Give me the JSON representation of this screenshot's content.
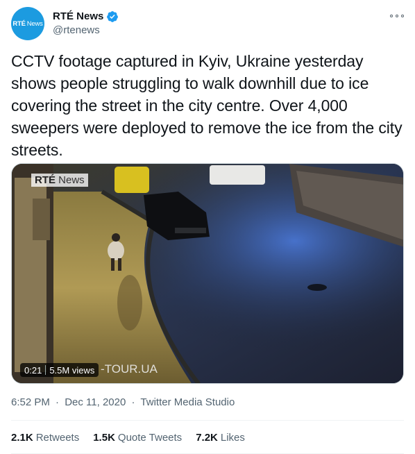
{
  "account": {
    "display_name": "RTÉ News",
    "handle": "@rtenews",
    "avatar_text_bold": "RTÉ",
    "avatar_text_thin": "News",
    "avatar_color": "#1c9be0",
    "verified": true
  },
  "tweet": {
    "text": "CCTV footage captured in Kyiv, Ukraine yesterday shows people struggling to walk downhill due to ice covering the street in the city centre. Over 4,000 sweepers were deployed to remove the ice from the city streets."
  },
  "media": {
    "watermark_bold": "RTÉ",
    "watermark_thin": "News",
    "duration": "0:21",
    "views": "5.5M views",
    "overlay_text": "-TOUR.UA"
  },
  "meta": {
    "time": "6:52 PM",
    "date": "Dec 11, 2020",
    "source": "Twitter Media Studio"
  },
  "stats": {
    "retweets_count": "2.1K",
    "retweets_label": "Retweets",
    "quotes_count": "1.5K",
    "quotes_label": "Quote Tweets",
    "likes_count": "7.2K",
    "likes_label": "Likes"
  },
  "colors": {
    "verified_blue": "#1d9bf0",
    "secondary_text": "#536471"
  }
}
